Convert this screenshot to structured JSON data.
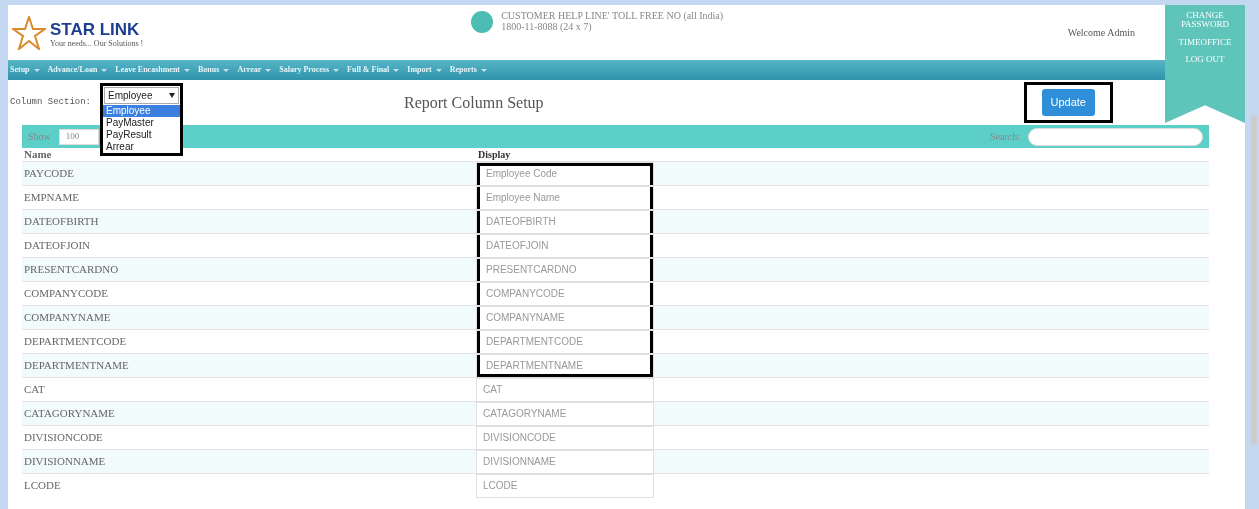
{
  "header": {
    "brand": "STAR LINK",
    "tagline": "Your needs... Our Solutions !",
    "helpline": "CUSTOMER HELP LINE' TOLL FREE NO (all India)",
    "phone": "1800-11-8088 (24 x 7)",
    "welcome": "Welcome Admin"
  },
  "nav": [
    {
      "label": "Setup"
    },
    {
      "label": "Advance/Loan"
    },
    {
      "label": "Leave Encashment"
    },
    {
      "label": "Bonus"
    },
    {
      "label": "Arrear"
    },
    {
      "label": "Salary Process"
    },
    {
      "label": "Full & Final"
    },
    {
      "label": "Import"
    },
    {
      "label": "Reports"
    }
  ],
  "account_menu": [
    {
      "label": "CHANGE PASSWORD"
    },
    {
      "label": "TIMEOFFICE"
    },
    {
      "label": "LOG OUT"
    }
  ],
  "section": {
    "label": "Column Section:",
    "value": "Employee",
    "options": [
      {
        "label": "Employee",
        "selected": true
      },
      {
        "label": "PayMaster",
        "selected": false
      },
      {
        "label": "PayResult",
        "selected": false
      },
      {
        "label": "Arrear",
        "selected": false
      }
    ]
  },
  "title": "Report Column Setup",
  "update_button": {
    "label": "Update",
    "highlighted": true
  },
  "toolbar": {
    "show_label": "Show",
    "show_value": "100",
    "search_label": "Search:"
  },
  "columns": [
    "Name",
    "Display"
  ],
  "rows": [
    {
      "name": "PAYCODE",
      "display": "Employee Code",
      "highlighted": true
    },
    {
      "name": "EMPNAME",
      "display": "Employee Name",
      "highlighted": true
    },
    {
      "name": "DATEOFBIRTH",
      "display": "DATEOFBIRTH",
      "highlighted": true
    },
    {
      "name": "DATEOFJOIN",
      "display": "DATEOFJOIN",
      "highlighted": true
    },
    {
      "name": "PRESENTCARDNO",
      "display": "PRESENTCARDNO",
      "highlighted": true
    },
    {
      "name": "COMPANYCODE",
      "display": "COMPANYCODE",
      "highlighted": true
    },
    {
      "name": "COMPANYNAME",
      "display": "COMPANYNAME",
      "highlighted": true
    },
    {
      "name": "DEPARTMENTCODE",
      "display": "DEPARTMENTCODE",
      "highlighted": true
    },
    {
      "name": "DEPARTMENTNAME",
      "display": "DEPARTMENTNAME",
      "highlighted": true
    },
    {
      "name": "CAT",
      "display": "CAT",
      "highlighted": false
    },
    {
      "name": "CATAGORYNAME",
      "display": "CATAGORYNAME",
      "highlighted": false
    },
    {
      "name": "DIVISIONCODE",
      "display": "DIVISIONCODE",
      "highlighted": false
    },
    {
      "name": "DIVISIONNAME",
      "display": "DIVISIONNAME",
      "highlighted": false
    },
    {
      "name": "LCODE",
      "display": "LCODE",
      "highlighted": false
    }
  ]
}
